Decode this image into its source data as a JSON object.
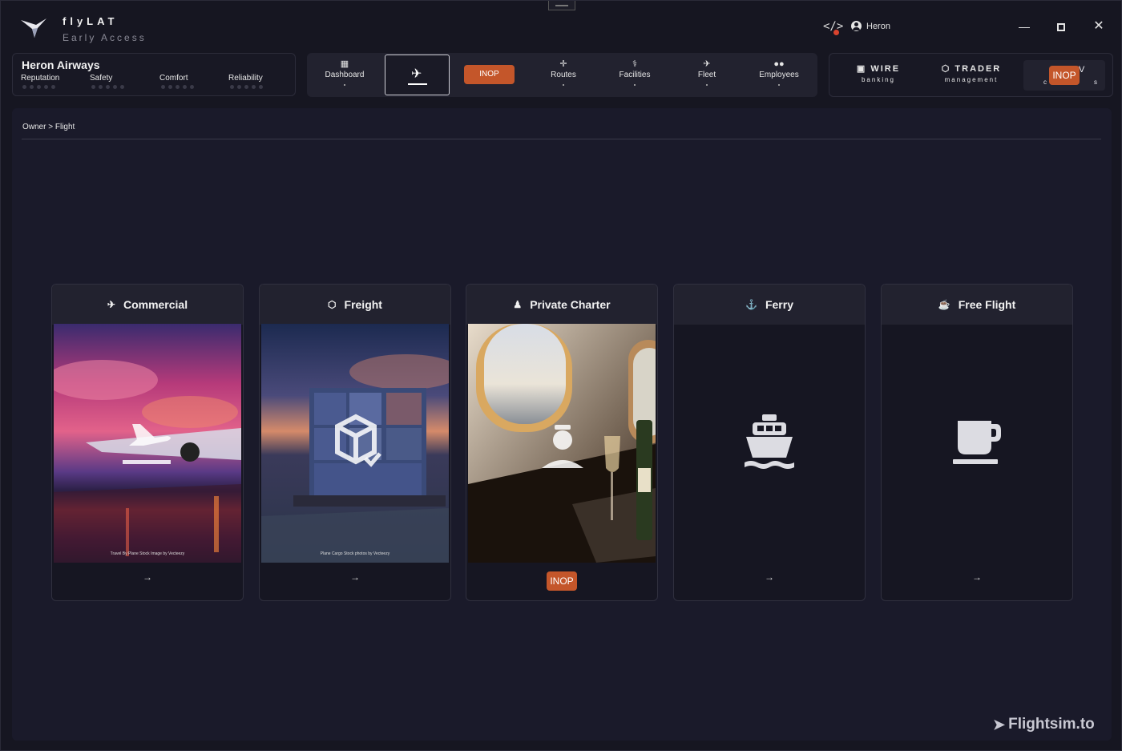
{
  "app": {
    "brand_name": "flyLAT",
    "brand_sub": "Early Access",
    "user_name": "Heron"
  },
  "airline": {
    "name": "Heron Airways",
    "metrics": [
      {
        "label": "Reputation",
        "level": 0
      },
      {
        "label": "Safety",
        "level": 0
      },
      {
        "label": "Comfort",
        "level": 0
      },
      {
        "label": "Reliability",
        "level": 0
      }
    ]
  },
  "nav": {
    "inop_label": "INOP",
    "items": [
      {
        "label": "Dashboard"
      },
      {
        "label": "Routes"
      },
      {
        "label": "Facilities"
      },
      {
        "label": "Fleet"
      },
      {
        "label": "Employees"
      }
    ]
  },
  "right_panel": {
    "wire_title": "WIRE",
    "wire_sub": "banking",
    "trader_title": "TRADER",
    "trader_sub": "management",
    "third_title": "V",
    "third_sub_left": "c",
    "third_sub_right": "s",
    "inop_label": "INOP"
  },
  "breadcrumb": {
    "root": "Owner",
    "sep": ">",
    "current": "Flight"
  },
  "cards": [
    {
      "title": "Commercial",
      "credit": "Travel By Plane Stock Image by Vecteezy",
      "footer": "→"
    },
    {
      "title": "Freight",
      "credit": "Plane Cargo Stock photos by Vecteezy",
      "footer": "→"
    },
    {
      "title": "Private Charter",
      "credit": "",
      "footer": "INOP"
    },
    {
      "title": "Ferry",
      "credit": "",
      "footer": "→"
    },
    {
      "title": "Free Flight",
      "credit": "",
      "footer": "→"
    }
  ],
  "watermark": "Flightsim.to",
  "colors": {
    "background": "#161621",
    "panel": "#22222f",
    "accent_inop": "#c4562a",
    "text": "#e8e8ee"
  }
}
